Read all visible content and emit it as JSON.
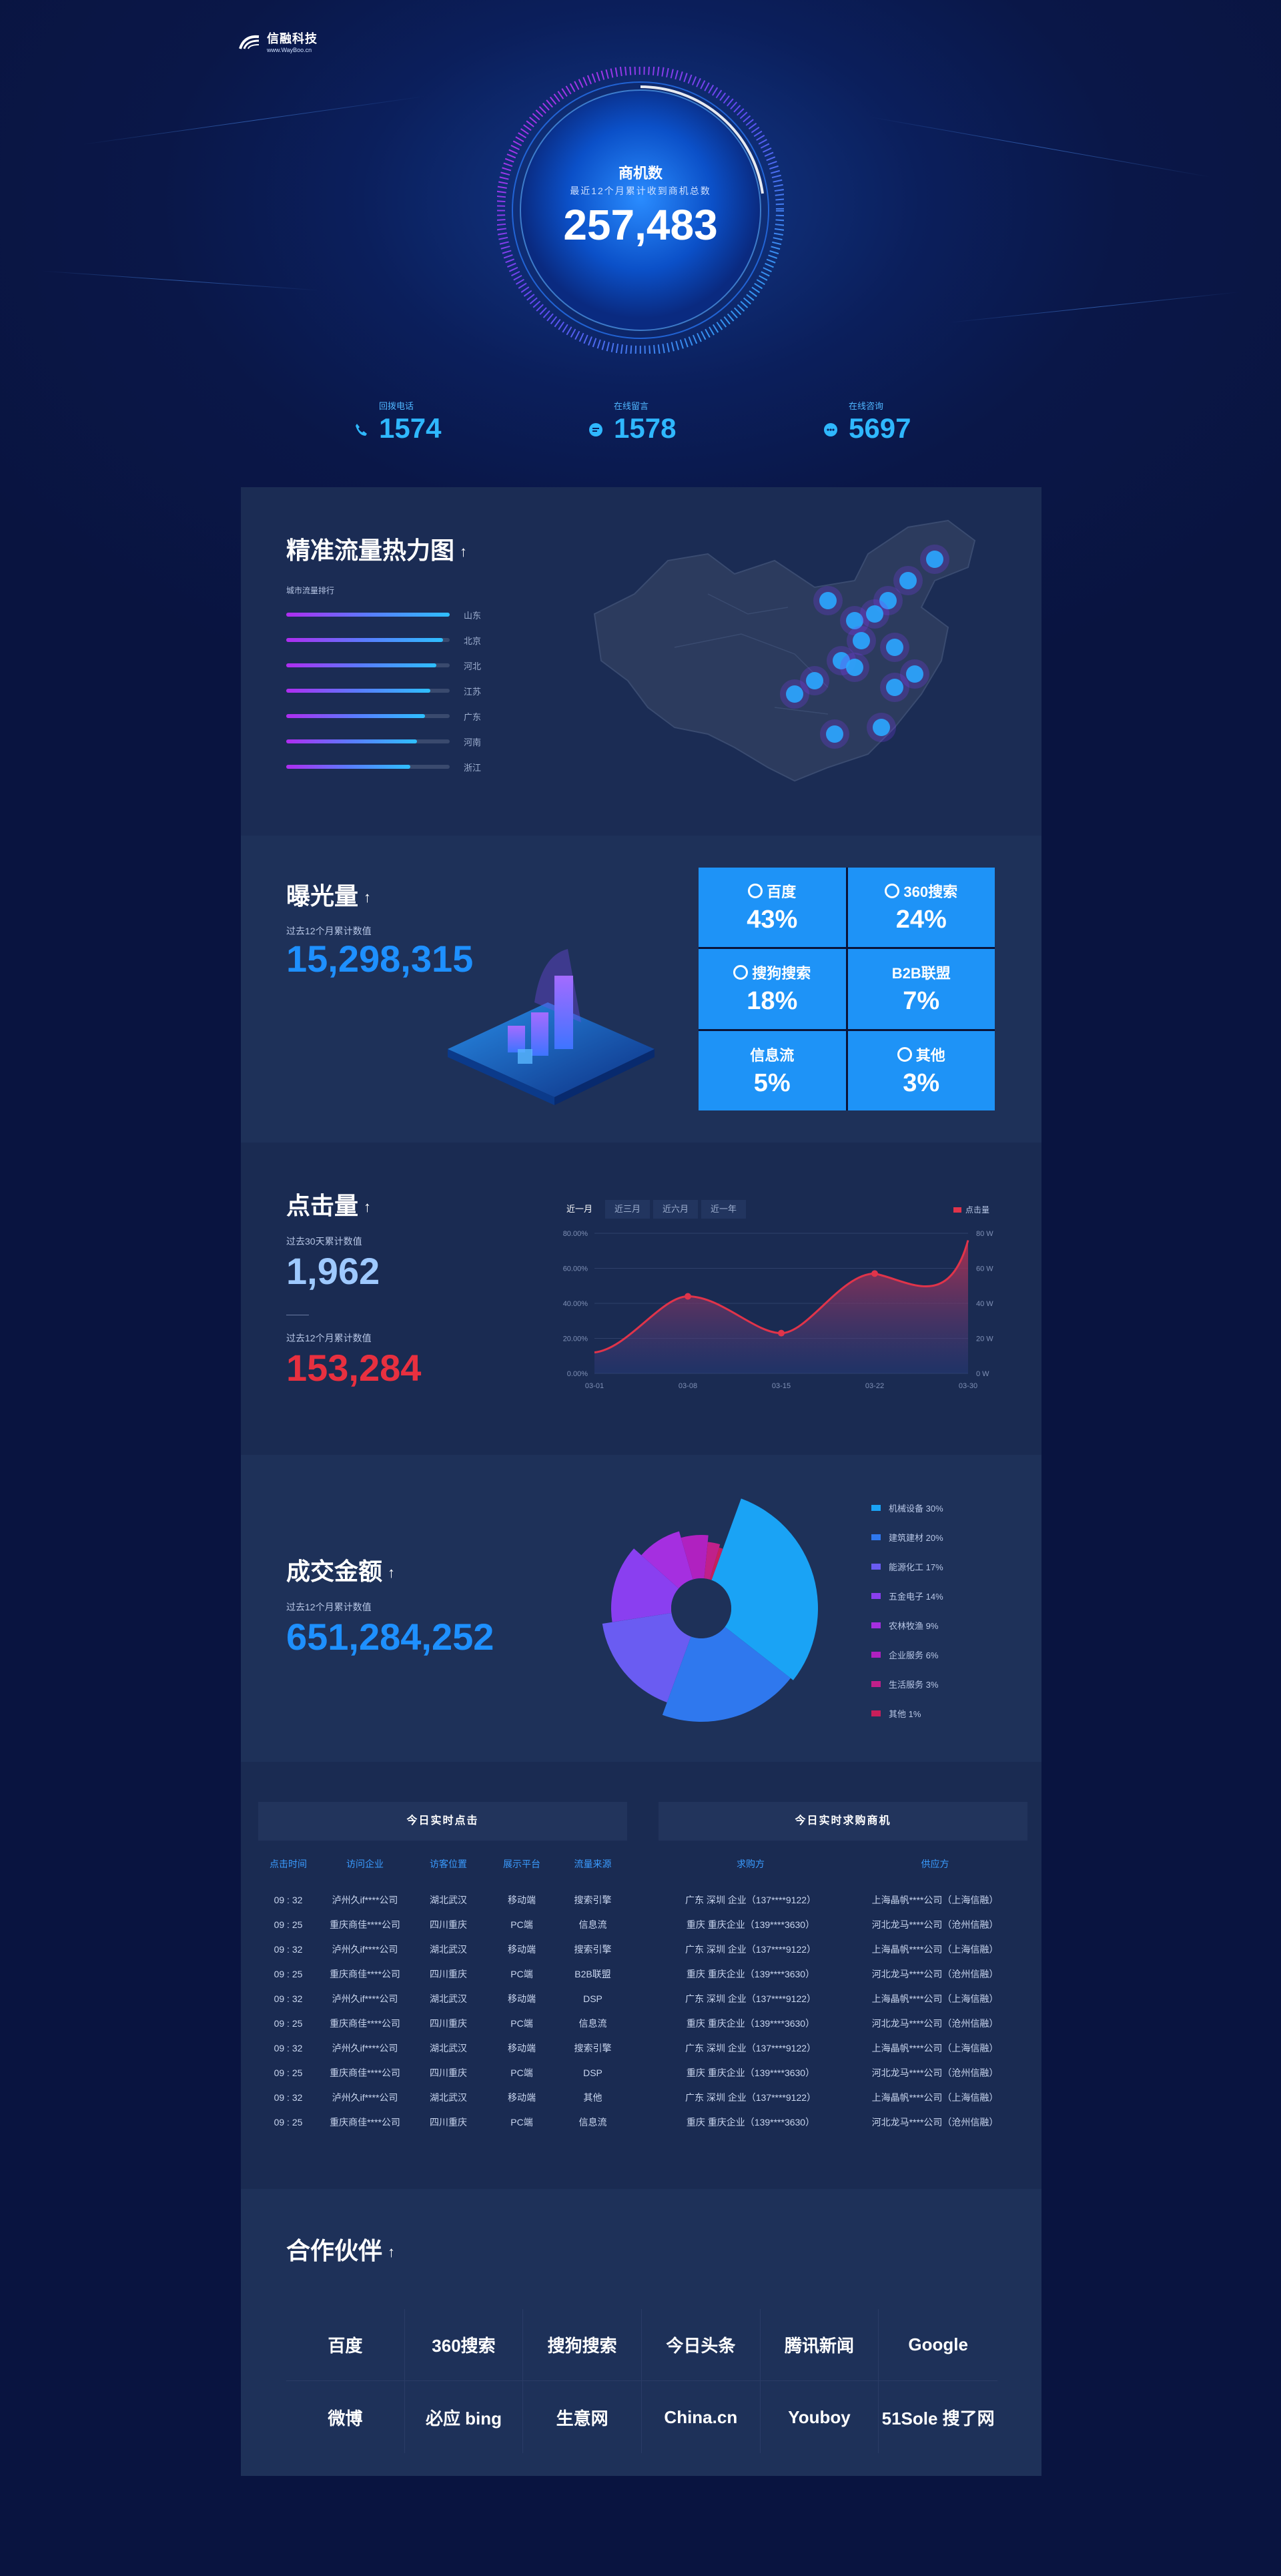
{
  "logo": {
    "name": "信融科技",
    "url": "www.WayBoo.cn"
  },
  "hero": {
    "title": "商机数",
    "subtitle": "最近12个月累计收到商机总数",
    "value": "257,483"
  },
  "stats": [
    {
      "label": "回拨电话",
      "value": "1574",
      "icon": "phone-icon"
    },
    {
      "label": "在线留言",
      "value": "1578",
      "icon": "message-icon"
    },
    {
      "label": "在线咨询",
      "value": "5697",
      "icon": "chat-icon"
    }
  ],
  "heatmap": {
    "title": "精准流量热力图",
    "arrow": "↑",
    "list_title": "城市流量排行",
    "cities": [
      {
        "name": "山东",
        "level": 1.0
      },
      {
        "name": "北京",
        "level": 0.96
      },
      {
        "name": "河北",
        "level": 0.92
      },
      {
        "name": "江苏",
        "level": 0.88
      },
      {
        "name": "广东",
        "level": 0.85
      },
      {
        "name": "河南",
        "level": 0.8
      },
      {
        "name": "浙江",
        "level": 0.76
      }
    ]
  },
  "exposure": {
    "title": "曝光量",
    "arrow": "↑",
    "sub": "过去12个月累计数值",
    "value": "15,298,315",
    "channels": [
      {
        "name": "百度",
        "pct": "43%",
        "icon": "baidu-icon"
      },
      {
        "name": "360搜索",
        "pct": "24%",
        "icon": "360-icon"
      },
      {
        "name": "搜狗搜索",
        "pct": "18%",
        "icon": "sogou-icon"
      },
      {
        "name": "B2B联盟",
        "pct": "7%",
        "icon": ""
      },
      {
        "name": "信息流",
        "pct": "5%",
        "icon": ""
      },
      {
        "name": "其他",
        "pct": "3%",
        "icon": "globe-icon"
      }
    ]
  },
  "clicks": {
    "title": "点击量",
    "arrow": "↑",
    "sub1": "过去30天累计数值",
    "value1": "1,962",
    "sub2": "过去12个月累计数值",
    "value2": "153,284",
    "tabs": [
      "近一月",
      "近三月",
      "近六月",
      "近一年"
    ],
    "active_tab": 0,
    "legend": "点击量",
    "colors": {
      "line": "#e0344a",
      "value1": "#9ec9ff",
      "value2": "#e8303f"
    }
  },
  "chart_data": {
    "type": "area",
    "x": [
      "03-01",
      "03-08",
      "03-15",
      "03-22",
      "03-30"
    ],
    "series": [
      {
        "name": "点击量",
        "points": [
          [
            0,
            12
          ],
          [
            1,
            44
          ],
          [
            2,
            23
          ],
          [
            3,
            57
          ],
          [
            4,
            76
          ]
        ]
      }
    ],
    "y_left_ticks": [
      "0.00%",
      "20.00%",
      "40.00%",
      "60.00%",
      "80.00%"
    ],
    "y_right_ticks": [
      "0 W",
      "20 W",
      "40 W",
      "60 W",
      "80 W"
    ],
    "ylim": [
      0,
      80
    ],
    "legend": "top-right"
  },
  "deals": {
    "title": "成交金额",
    "arrow": "↑",
    "sub": "过去12个月累计数值",
    "value": "651,284,252",
    "slices": [
      {
        "label": "机械设备 30%",
        "value": 30,
        "color": "#1aa3f5"
      },
      {
        "label": "建筑建材 20%",
        "value": 20,
        "color": "#2f78ee"
      },
      {
        "label": "能源化工 17%",
        "value": 17,
        "color": "#6a5cf2"
      },
      {
        "label": "五金电子 14%",
        "value": 14,
        "color": "#8a3ff0"
      },
      {
        "label": "农林牧渔 9%",
        "value": 9,
        "color": "#a52fe0"
      },
      {
        "label": "企业服务 6%",
        "value": 6,
        "color": "#b021c0"
      },
      {
        "label": "生活服务 3%",
        "value": 3,
        "color": "#c0208a"
      },
      {
        "label": "其他 1%",
        "value": 1,
        "color": "#c81f5a"
      }
    ]
  },
  "realtime_clicks": {
    "title": "今日实时点击",
    "columns": [
      "点击时间",
      "访问企业",
      "访客位置",
      "展示平台",
      "流量来源"
    ],
    "rows": [
      [
        "09 : 32",
        "泸州久if****公司",
        "湖北武汉",
        "移动端",
        "搜索引擎"
      ],
      [
        "09 : 25",
        "重庆商佳****公司",
        "四川重庆",
        "PC端",
        "信息流"
      ],
      [
        "09 : 32",
        "泸州久if****公司",
        "湖北武汉",
        "移动端",
        "搜索引擎"
      ],
      [
        "09 : 25",
        "重庆商佳****公司",
        "四川重庆",
        "PC端",
        "B2B联盟"
      ],
      [
        "09 : 32",
        "泸州久if****公司",
        "湖北武汉",
        "移动端",
        "DSP"
      ],
      [
        "09 : 25",
        "重庆商佳****公司",
        "四川重庆",
        "PC端",
        "信息流"
      ],
      [
        "09 : 32",
        "泸州久if****公司",
        "湖北武汉",
        "移动端",
        "搜索引擎"
      ],
      [
        "09 : 25",
        "重庆商佳****公司",
        "四川重庆",
        "PC端",
        "DSP"
      ],
      [
        "09 : 32",
        "泸州久if****公司",
        "湖北武汉",
        "移动端",
        "其他"
      ],
      [
        "09 : 25",
        "重庆商佳****公司",
        "四川重庆",
        "PC端",
        "信息流"
      ]
    ]
  },
  "realtime_buyers": {
    "title": "今日实时求购商机",
    "columns": [
      "求购方",
      "供应方"
    ],
    "rows": [
      [
        "广东 深圳 企业（137****9122）",
        "上海晶帆****公司（上海信融）"
      ],
      [
        "重庆 重庆企业（139****3630）",
        "河北龙马****公司（沧州信融）"
      ],
      [
        "广东 深圳 企业（137****9122）",
        "上海晶帆****公司（上海信融）"
      ],
      [
        "重庆 重庆企业（139****3630）",
        "河北龙马****公司（沧州信融）"
      ],
      [
        "广东 深圳 企业（137****9122）",
        "上海晶帆****公司（上海信融）"
      ],
      [
        "重庆 重庆企业（139****3630）",
        "河北龙马****公司（沧州信融）"
      ],
      [
        "广东 深圳 企业（137****9122）",
        "上海晶帆****公司（上海信融）"
      ],
      [
        "重庆 重庆企业（139****3630）",
        "河北龙马****公司（沧州信融）"
      ],
      [
        "广东 深圳 企业（137****9122）",
        "上海晶帆****公司（上海信融）"
      ],
      [
        "重庆 重庆企业（139****3630）",
        "河北龙马****公司（沧州信融）"
      ]
    ]
  },
  "partners": {
    "title": "合作伙伴",
    "arrow": "↑",
    "logos": [
      "百度",
      "360搜索",
      "搜狗搜索",
      "今日头条",
      "腾讯新闻",
      "Google",
      "微博",
      "必应 bing",
      "生意网",
      "China.cn",
      "Youboy",
      "51Sole 搜了网"
    ]
  }
}
